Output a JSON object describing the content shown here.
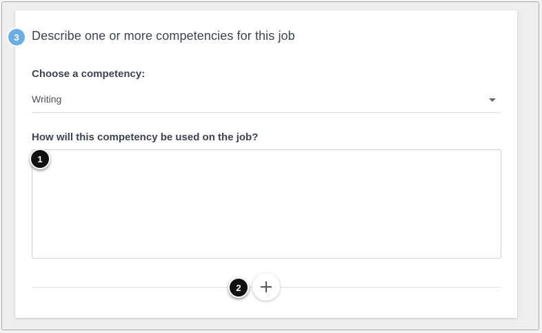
{
  "section": {
    "step_number": "3",
    "title": "Describe one or more competencies for this job"
  },
  "competency": {
    "label": "Choose a competency:",
    "selected": "Writing"
  },
  "usage": {
    "label": "How will this competency be used on the job?",
    "value": ""
  },
  "annotations": {
    "marker_1": "1",
    "marker_2": "2"
  },
  "icons": {
    "dropdown": "caret-down-icon",
    "add": "plus-icon"
  },
  "colors": {
    "step_badge": "#6aaee6",
    "annotation_marker": "#111111"
  }
}
